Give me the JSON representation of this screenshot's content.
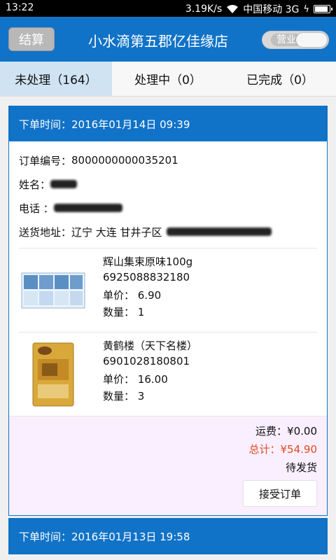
{
  "status": {
    "time": "13:22",
    "speed": "3.19K/s",
    "carrier": "中国移动 3G",
    "bolt": "ϟ"
  },
  "appbar": {
    "settle_label": "结算",
    "title": "小水滴第五郡亿佳缘店",
    "toggle_label": "营业"
  },
  "tabs": [
    {
      "label": "未处理",
      "count": "（164）"
    },
    {
      "label": "处理中",
      "count": "（0）"
    },
    {
      "label": "已完成",
      "count": "（0）"
    }
  ],
  "orders": [
    {
      "time_label": "下单时间：",
      "time": "2016年01月14日 09:39",
      "order_no_label": "订单编号：",
      "order_no": "8000000000035201",
      "name_label": "姓名：",
      "phone_label": "电话 ：",
      "address_label": "送货地址：",
      "address": "辽宁 大连 甘井子区",
      "items": [
        {
          "name": "辉山集束原味100g",
          "barcode": "6925088832180",
          "price_label": "单价：",
          "price": "6.90",
          "qty_label": "数量：",
          "qty": "1"
        },
        {
          "name": "黄鹤楼（天下名楼）",
          "barcode": "6901028180801",
          "price_label": "单价：",
          "price": "16.00",
          "qty_label": "数量：",
          "qty": "3"
        }
      ],
      "shipping": "运费：¥0.00",
      "total": "总计：¥54.90",
      "status": "待发货",
      "accept_label": "接受订单"
    },
    {
      "time_label": "下单时间：",
      "time": "2016年01月13日 19:58"
    }
  ],
  "colors": {
    "primary": "#1173c7",
    "total": "#e24a20",
    "summary_bg": "#f9efff",
    "active_tab": "#cfe3f3"
  }
}
